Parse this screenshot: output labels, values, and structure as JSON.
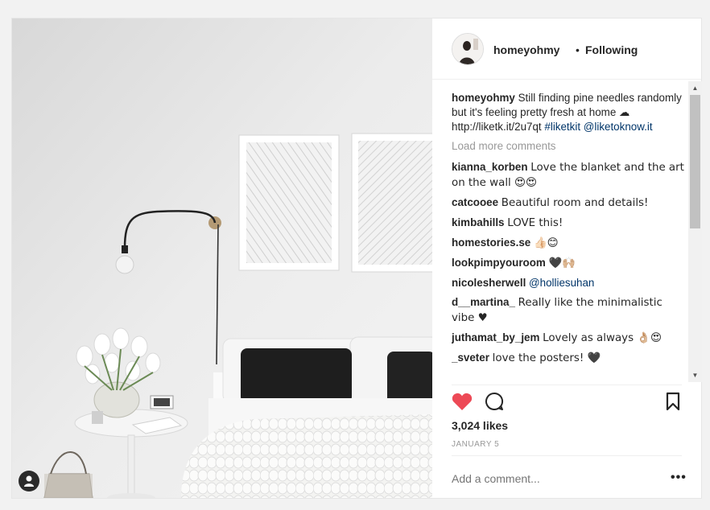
{
  "header": {
    "username": "homeyohmy",
    "separator": "•",
    "follow_status": "Following"
  },
  "caption": {
    "username": "homeyohmy",
    "text": "Still finding pine needles randomly but it's feeling pretty fresh at home ☁ http://liketk.it/2u7qt",
    "hashtag": "#liketkit",
    "mention": "@liketoknow.it"
  },
  "load_more": "Load more comments",
  "comments": [
    {
      "user": "kianna_korben",
      "text": "Love the blanket and the art on the wall 😍😍"
    },
    {
      "user": "catcooee",
      "text": "Beautiful room and details!"
    },
    {
      "user": "kimbahills",
      "text": "LOVE this!"
    },
    {
      "user": "homestories.se",
      "text": "👍🏻😊"
    },
    {
      "user": "lookpimpyouroom",
      "text": "🖤🙌🏼"
    },
    {
      "user": "nicolesherwell",
      "text": "",
      "mention": "@holliesuhan"
    },
    {
      "user": "d__martina_",
      "text": "Really like the minimalistic vibe ♥"
    },
    {
      "user": "juthamat_by_jem",
      "text": "Lovely as always 👌🏼😍"
    },
    {
      "user": "_sveter",
      "text": "love the posters! 🖤"
    }
  ],
  "actions": {
    "like_icon": "heart-icon",
    "comment_icon": "comment-icon",
    "save_icon": "bookmark-icon",
    "like_color": "#ed4956"
  },
  "likes": "3,024 likes",
  "date": "JANUARY 5",
  "add_comment": {
    "placeholder": "Add a comment..."
  },
  "more_options": "•••"
}
